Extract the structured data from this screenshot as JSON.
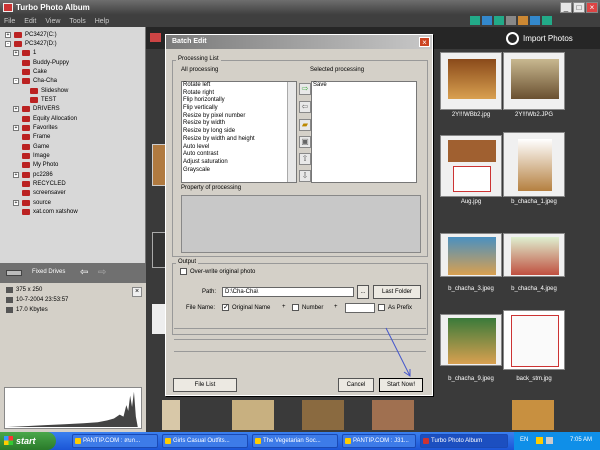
{
  "app": {
    "title": "Turbo Photo Album",
    "menu": [
      "File",
      "Edit",
      "View",
      "Tools",
      "Help"
    ],
    "import_label": "Import Photos"
  },
  "tree": [
    {
      "label": "PC3427(C:)",
      "depth": 0,
      "exp": "+"
    },
    {
      "label": "PC3427(D:)",
      "depth": 0,
      "exp": "-"
    },
    {
      "label": "1",
      "depth": 1,
      "exp": "+"
    },
    {
      "label": "Buddy-Puppy",
      "depth": 1,
      "exp": ""
    },
    {
      "label": "Cake",
      "depth": 1,
      "exp": ""
    },
    {
      "label": "Cha-Cha",
      "depth": 1,
      "exp": "-"
    },
    {
      "label": "Slideshow",
      "depth": 2,
      "exp": ""
    },
    {
      "label": "TEST",
      "depth": 2,
      "exp": ""
    },
    {
      "label": "DRIVERS",
      "depth": 1,
      "exp": "+"
    },
    {
      "label": "Equity Allocation",
      "depth": 1,
      "exp": ""
    },
    {
      "label": "Favorites",
      "depth": 1,
      "exp": "+"
    },
    {
      "label": "Frame",
      "depth": 1,
      "exp": ""
    },
    {
      "label": "Game",
      "depth": 1,
      "exp": ""
    },
    {
      "label": "Image",
      "depth": 1,
      "exp": ""
    },
    {
      "label": "My Photo",
      "depth": 1,
      "exp": ""
    },
    {
      "label": "pc2286",
      "depth": 1,
      "exp": "+"
    },
    {
      "label": "RECYCLED",
      "depth": 1,
      "exp": ""
    },
    {
      "label": "screensaver",
      "depth": 1,
      "exp": ""
    },
    {
      "label": "source",
      "depth": 1,
      "exp": "+"
    },
    {
      "label": "xat.com xatshow",
      "depth": 1,
      "exp": ""
    }
  ],
  "drive_bar": {
    "label": "Fixed Drives"
  },
  "info": {
    "dimensions": "375 x 250",
    "datetime": "10-7-2004 23:53:57",
    "size": "17.0 Kbytes"
  },
  "thumbnails": [
    {
      "label": "2Y!!!WBb2.jpg",
      "col": 0,
      "row": 0
    },
    {
      "label": "2Y!!!Wb2.JPG",
      "col": 1,
      "row": 0
    },
    {
      "label": "Aug.jpg",
      "col": 0,
      "row": 1
    },
    {
      "label": "b_chacha_1.jpeg",
      "col": 1,
      "row": 1
    },
    {
      "label": "b_chacha_3.jpeg",
      "col": 0,
      "row": 2
    },
    {
      "label": "b_chacha_4.jpeg",
      "col": 1,
      "row": 2
    },
    {
      "label": "b_chacha_9.jpeg",
      "col": 0,
      "row": 3
    },
    {
      "label": "back_stm.jpg",
      "col": 1,
      "row": 3
    }
  ],
  "dialog": {
    "title": "Batch Edit",
    "processing_list_label": "Processing List",
    "all_processing_label": "All processing",
    "selected_processing_label": "Selected processing",
    "all_items": [
      "Rotate left",
      "Rotate right",
      "Flip horizontally",
      "Flip vertically",
      "Resize by pixel number",
      "Resize by width",
      "Resize by long side",
      "Resize by width and height",
      "Auto level",
      "Auto contrast",
      "Adjust saturation",
      "Grayscale"
    ],
    "selected_items": [
      "Save"
    ],
    "property_label": "Property of processing",
    "output_label": "Output",
    "overwrite_label": "Over-write original photo",
    "path_label": "Path:",
    "path_value": "D:\\Cha-Cha\\",
    "browse_label": "...",
    "last_folder_label": "Last Folder",
    "file_name_label": "File Name:",
    "original_name_label": "Original Name",
    "plus1": "+",
    "number_label": "Number",
    "plus2": "+",
    "as_prefix_label": "As Prefix",
    "file_list_label": "File List",
    "cancel_label": "Cancel",
    "start_label": "Start Now!"
  },
  "taskbar": {
    "start_label": "start",
    "tasks": [
      "PANTIP.COM : สบก...",
      "Girls Casual Outfits...",
      "The Vegetarian Soc...",
      "PANTIP.COM : J31...",
      "Turbo Photo Album"
    ],
    "lang": "EN",
    "clock": "7:05 AM"
  }
}
